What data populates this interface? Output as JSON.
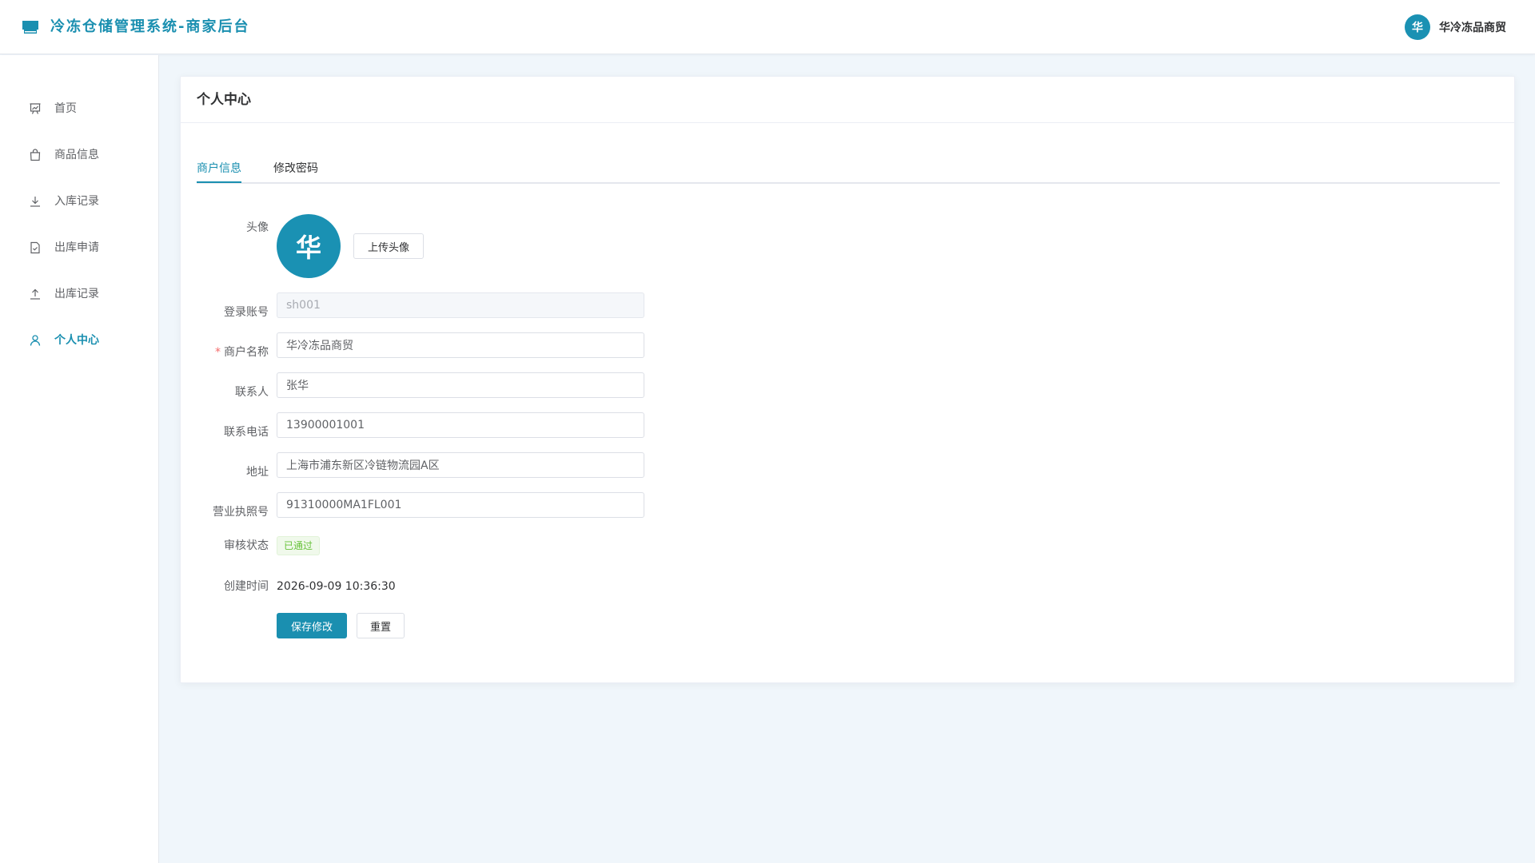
{
  "header": {
    "title": "冷冻仓储管理系统-商家后台",
    "user_avatar_text": "华",
    "user_name": "华冷冻品商贸"
  },
  "sidebar": {
    "items": [
      {
        "label": "首页",
        "icon": "dashboard-icon"
      },
      {
        "label": "商品信息",
        "icon": "shopping-bag-icon"
      },
      {
        "label": "入库记录",
        "icon": "download-icon"
      },
      {
        "label": "出库申请",
        "icon": "document-check-icon"
      },
      {
        "label": "出库记录",
        "icon": "upload-icon"
      },
      {
        "label": "个人中心",
        "icon": "user-icon",
        "active": true
      }
    ]
  },
  "card": {
    "title": "个人中心"
  },
  "tabs": [
    {
      "label": "商户信息",
      "active": true
    },
    {
      "label": "修改密码",
      "active": false
    }
  ],
  "form": {
    "avatar_label": "头像",
    "avatar_text": "华",
    "upload_button": "上传头像",
    "account_label": "登录账号",
    "account_value": "sh001",
    "merchant_name_label": "商户名称",
    "merchant_name_value": "华冷冻品商贸",
    "contact_label": "联系人",
    "contact_value": "张华",
    "phone_label": "联系电话",
    "phone_value": "13900001001",
    "address_label": "地址",
    "address_value": "上海市浦东新区冷链物流园A区",
    "license_label": "营业执照号",
    "license_value": "91310000MA1FL001",
    "status_label": "审核状态",
    "status_value": "已通过",
    "created_label": "创建时间",
    "created_value": "2026-09-09 10:36:30",
    "required_mark": "*",
    "save_button": "保存修改",
    "reset_button": "重置"
  },
  "colors": {
    "primary": "#1a8fb0",
    "success": "#67c23a",
    "background": "#f0f6fb",
    "required": "#f56c6c"
  }
}
